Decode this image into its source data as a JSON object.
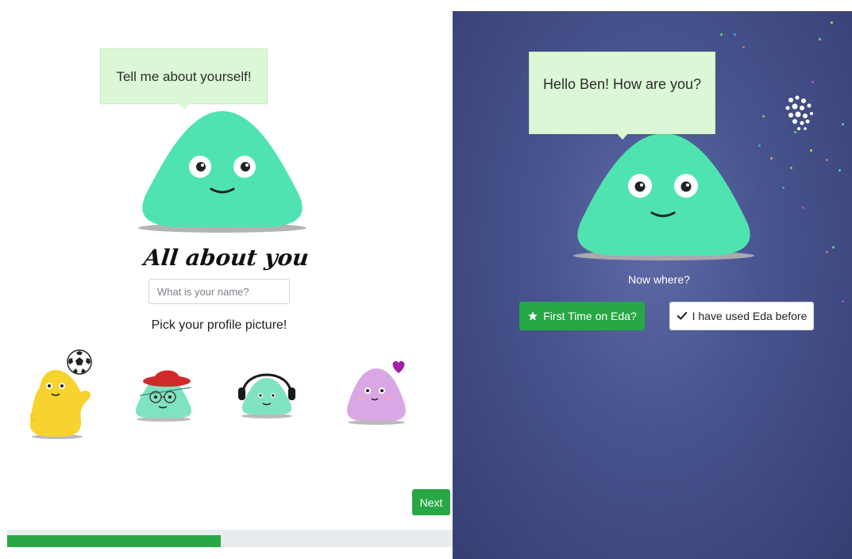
{
  "left": {
    "bubble_text": "Tell me about yourself!",
    "title": "All about you",
    "name_input": {
      "value": "",
      "placeholder": "What is your name?"
    },
    "pick_label": "Pick your profile picture!",
    "avatars": [
      "yellow-soccer-avatar",
      "green-hat-glasses-avatar",
      "green-headphones-avatar",
      "purple-heart-avatar"
    ],
    "next_label": "Next",
    "progress_fraction": 0.48
  },
  "right": {
    "bubble_text": "Hello Ben! How are you?",
    "prompt": "Now where?",
    "first_time_label": "First Time on Eda?",
    "used_before_label": "I have used Eda before",
    "first_time_icon": "star-icon",
    "used_before_icon": "check-icon"
  },
  "colors": {
    "accent_green": "#28a745",
    "blob_mint": "#4fe3b0",
    "bubble_bg": "#dcf7d6",
    "right_bg": "#48548f"
  }
}
